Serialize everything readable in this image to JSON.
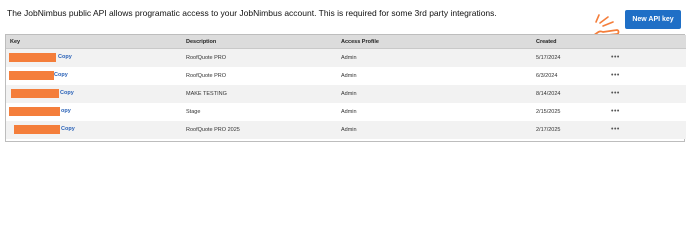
{
  "header": {
    "intro_text": "The JobNimbus public API allows programatic access to your JobNimbus account. This is required for some 3rd party integrations.",
    "new_key_label": "New API key"
  },
  "table": {
    "columns": [
      "Key",
      "Description",
      "Access Profile",
      "Created"
    ],
    "rows": [
      {
        "copy_label": "Copy",
        "description": "RoofQuote PRO",
        "access_profile": "Admin",
        "created": "5/17/2024",
        "more": "•••"
      },
      {
        "copy_label": "Copy",
        "description": "RoofQuote PRO",
        "access_profile": "Admin",
        "created": "6/3/2024",
        "more": "•••"
      },
      {
        "copy_label": "Copy",
        "description": "MAKE TESTING",
        "access_profile": "Admin",
        "created": "8/14/2024",
        "more": "•••"
      },
      {
        "copy_label": "opy",
        "description": "Stage",
        "access_profile": "Admin",
        "created": "2/15/2025",
        "more": "•••"
      },
      {
        "copy_label": "Copy",
        "description": "RoofQuote PRO 2025",
        "access_profile": "Admin",
        "created": "2/17/2025",
        "more": "•••"
      }
    ]
  },
  "colors": {
    "accent": "#1f6fc6",
    "redaction": "#f47e3b",
    "link": "#2a62b8",
    "header_bg": "#dcdcdc"
  },
  "icons": {
    "pointer": "pointing-hand-icon",
    "row_menu": "more-horizontal-icon"
  }
}
